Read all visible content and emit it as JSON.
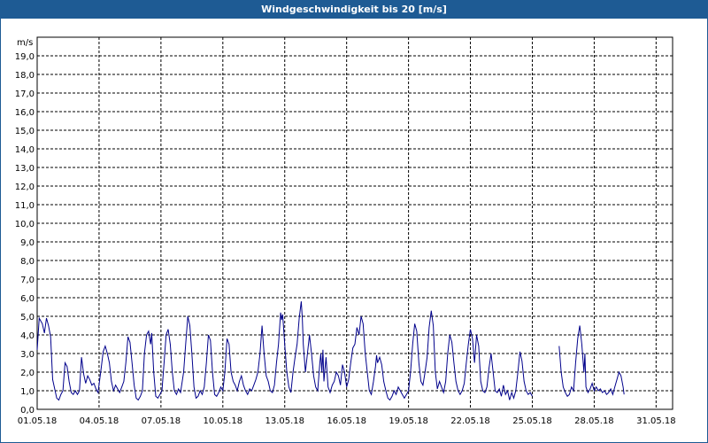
{
  "title": "Windgeschwindigkeit bis 20 [m/s]",
  "colors": {
    "titlebar": "#1e5b94",
    "series": "#00008b",
    "grid": "#000000"
  },
  "chart_data": {
    "type": "line",
    "title": "Windgeschwindigkeit bis 20 [m/s]",
    "ylabel": "m/s",
    "xlabel": "",
    "ylim": [
      0,
      20
    ],
    "y_ticks": [
      "0,0",
      "1,0",
      "2,0",
      "3,0",
      "4,0",
      "5,0",
      "6,0",
      "7,0",
      "8,0",
      "9,0",
      "10,0",
      "11,0",
      "12,0",
      "13,0",
      "14,0",
      "15,0",
      "16,0",
      "17,0",
      "18,0",
      "19,0"
    ],
    "x_tick_labels": [
      "01.05.18",
      "04.05.18",
      "07.05.18",
      "10.05.18",
      "13.05.18",
      "16.05.18",
      "19.05.18",
      "22.05.18",
      "25.05.18",
      "28.05.18",
      "31.05.18"
    ],
    "x_unit": "day of May 2018",
    "xlim": [
      1,
      31.8
    ],
    "grid": true,
    "series": [
      {
        "segments": [
          [
            [
              1.0,
              3.2
            ],
            [
              1.1,
              4.9
            ],
            [
              1.25,
              4.6
            ],
            [
              1.35,
              4.1
            ],
            [
              1.45,
              4.9
            ],
            [
              1.55,
              4.5
            ],
            [
              1.65,
              3.9
            ],
            [
              1.75,
              1.6
            ],
            [
              1.85,
              1.1
            ],
            [
              1.95,
              0.6
            ],
            [
              2.05,
              0.5
            ],
            [
              2.15,
              0.8
            ],
            [
              2.25,
              1.0
            ],
            [
              2.35,
              2.5
            ],
            [
              2.45,
              2.3
            ],
            [
              2.55,
              1.5
            ],
            [
              2.65,
              0.9
            ],
            [
              2.75,
              0.8
            ],
            [
              2.85,
              1.0
            ],
            [
              2.95,
              0.8
            ],
            [
              3.05,
              1.0
            ],
            [
              3.15,
              2.8
            ],
            [
              3.25,
              1.9
            ],
            [
              3.35,
              1.4
            ],
            [
              3.45,
              1.8
            ],
            [
              3.55,
              1.6
            ],
            [
              3.65,
              1.3
            ],
            [
              3.75,
              1.4
            ],
            [
              3.85,
              1.1
            ],
            [
              3.95,
              0.9
            ],
            [
              4.1,
              2.2
            ],
            [
              4.2,
              3.1
            ],
            [
              4.3,
              3.4
            ],
            [
              4.4,
              3.0
            ],
            [
              4.5,
              2.5
            ],
            [
              4.6,
              1.5
            ],
            [
              4.7,
              1.0
            ],
            [
              4.8,
              1.3
            ],
            [
              4.9,
              1.1
            ],
            [
              5.0,
              0.9
            ],
            [
              5.1,
              1.2
            ],
            [
              5.2,
              1.5
            ],
            [
              5.3,
              2.5
            ],
            [
              5.4,
              3.9
            ],
            [
              5.5,
              3.6
            ],
            [
              5.6,
              2.5
            ],
            [
              5.7,
              1.3
            ],
            [
              5.8,
              0.6
            ],
            [
              5.9,
              0.5
            ],
            [
              6.0,
              0.7
            ],
            [
              6.1,
              1.0
            ],
            [
              6.2,
              3.0
            ],
            [
              6.3,
              4.0
            ],
            [
              6.4,
              4.2
            ],
            [
              6.5,
              3.5
            ],
            [
              6.55,
              4.1
            ],
            [
              6.65,
              2.0
            ],
            [
              6.75,
              0.7
            ],
            [
              6.85,
              0.6
            ],
            [
              6.95,
              0.8
            ],
            [
              7.05,
              1.0
            ],
            [
              7.15,
              2.5
            ],
            [
              7.25,
              4.0
            ],
            [
              7.35,
              4.3
            ],
            [
              7.45,
              3.5
            ],
            [
              7.55,
              2.0
            ],
            [
              7.65,
              1.0
            ],
            [
              7.75,
              0.8
            ],
            [
              7.85,
              1.1
            ],
            [
              7.95,
              0.9
            ],
            [
              8.1,
              2.0
            ],
            [
              8.2,
              3.5
            ],
            [
              8.3,
              5.0
            ],
            [
              8.4,
              4.5
            ],
            [
              8.5,
              3.0
            ],
            [
              8.6,
              1.2
            ],
            [
              8.7,
              0.6
            ],
            [
              8.8,
              0.7
            ],
            [
              8.9,
              1.0
            ],
            [
              9.0,
              0.8
            ],
            [
              9.1,
              1.2
            ],
            [
              9.2,
              2.5
            ],
            [
              9.3,
              4.0
            ],
            [
              9.4,
              3.7
            ],
            [
              9.5,
              2.0
            ],
            [
              9.6,
              0.8
            ],
            [
              9.7,
              0.7
            ],
            [
              9.8,
              0.9
            ],
            [
              9.9,
              1.2
            ],
            [
              10.0,
              1.0
            ],
            [
              10.1,
              2.0
            ],
            [
              10.2,
              3.8
            ],
            [
              10.3,
              3.5
            ],
            [
              10.4,
              2.0
            ],
            [
              10.5,
              1.5
            ],
            [
              10.6,
              1.3
            ],
            [
              10.7,
              1.0
            ],
            [
              10.8,
              1.5
            ],
            [
              10.9,
              1.8
            ],
            [
              11.0,
              1.3
            ],
            [
              11.1,
              1.0
            ],
            [
              11.2,
              0.8
            ],
            [
              11.3,
              1.1
            ],
            [
              11.4,
              1.0
            ],
            [
              11.5,
              1.3
            ],
            [
              11.6,
              1.6
            ],
            [
              11.7,
              2.0
            ],
            [
              11.8,
              3.0
            ],
            [
              11.9,
              4.5
            ],
            [
              12.0,
              3.0
            ],
            [
              12.1,
              1.8
            ],
            [
              12.2,
              1.5
            ],
            [
              12.3,
              1.0
            ],
            [
              12.4,
              0.9
            ],
            [
              12.5,
              1.3
            ],
            [
              12.6,
              2.5
            ],
            [
              12.7,
              3.5
            ],
            [
              12.8,
              5.2
            ],
            [
              12.85,
              4.8
            ],
            [
              12.9,
              5.1
            ],
            [
              13.0,
              3.5
            ],
            [
              13.1,
              2.0
            ],
            [
              13.2,
              1.2
            ],
            [
              13.3,
              0.9
            ],
            [
              13.4,
              2.0
            ],
            [
              13.5,
              2.8
            ],
            [
              13.6,
              3.5
            ],
            [
              13.7,
              4.9
            ],
            [
              13.8,
              5.8
            ],
            [
              13.85,
              4.9
            ],
            [
              13.9,
              3.5
            ],
            [
              14.0,
              2.0
            ],
            [
              14.1,
              3.0
            ],
            [
              14.2,
              4.0
            ],
            [
              14.3,
              3.0
            ],
            [
              14.4,
              1.8
            ],
            [
              14.5,
              1.2
            ],
            [
              14.6,
              1.0
            ],
            [
              14.7,
              2.5
            ],
            [
              14.75,
              3.0
            ],
            [
              14.8,
              2.0
            ],
            [
              14.85,
              3.2
            ],
            [
              14.9,
              1.5
            ],
            [
              15.0,
              2.8
            ],
            [
              15.1,
              1.2
            ],
            [
              15.2,
              0.9
            ],
            [
              15.3,
              1.3
            ],
            [
              15.4,
              1.5
            ],
            [
              15.5,
              2.0
            ],
            [
              15.6,
              1.8
            ],
            [
              15.7,
              1.3
            ],
            [
              15.8,
              2.4
            ],
            [
              15.9,
              2.0
            ],
            [
              16.0,
              1.2
            ],
            [
              16.1,
              1.6
            ],
            [
              16.2,
              2.5
            ],
            [
              16.3,
              3.3
            ],
            [
              16.4,
              3.5
            ],
            [
              16.5,
              4.4
            ],
            [
              16.6,
              4.0
            ],
            [
              16.7,
              5.0
            ],
            [
              16.8,
              4.6
            ],
            [
              16.9,
              3.0
            ],
            [
              17.0,
              2.0
            ],
            [
              17.1,
              1.0
            ],
            [
              17.2,
              0.8
            ],
            [
              17.3,
              1.5
            ],
            [
              17.4,
              2.3
            ],
            [
              17.45,
              2.9
            ],
            [
              17.5,
              2.5
            ],
            [
              17.6,
              2.8
            ],
            [
              17.7,
              2.4
            ],
            [
              17.8,
              1.5
            ],
            [
              17.9,
              1.0
            ],
            [
              18.0,
              0.6
            ],
            [
              18.1,
              0.5
            ],
            [
              18.2,
              0.7
            ],
            [
              18.3,
              1.0
            ],
            [
              18.4,
              0.8
            ],
            [
              18.5,
              1.2
            ],
            [
              18.6,
              1.0
            ],
            [
              18.7,
              0.8
            ],
            [
              18.8,
              0.6
            ],
            [
              18.9,
              0.8
            ],
            [
              19.0,
              1.0
            ],
            [
              19.1,
              2.0
            ],
            [
              19.2,
              3.5
            ],
            [
              19.3,
              4.6
            ],
            [
              19.4,
              4.2
            ],
            [
              19.5,
              2.5
            ],
            [
              19.6,
              1.5
            ],
            [
              19.7,
              1.3
            ],
            [
              19.8,
              2.0
            ],
            [
              19.9,
              2.8
            ],
            [
              20.0,
              4.4
            ],
            [
              20.1,
              5.3
            ],
            [
              20.2,
              4.5
            ],
            [
              20.3,
              2.0
            ],
            [
              20.4,
              1.1
            ],
            [
              20.5,
              1.5
            ],
            [
              20.6,
              1.2
            ],
            [
              20.7,
              0.9
            ],
            [
              20.8,
              1.5
            ],
            [
              20.9,
              3.0
            ],
            [
              21.0,
              4.0
            ],
            [
              21.1,
              3.6
            ],
            [
              21.2,
              2.5
            ],
            [
              21.3,
              1.5
            ],
            [
              21.4,
              1.0
            ],
            [
              21.5,
              0.8
            ],
            [
              21.6,
              1.0
            ],
            [
              21.7,
              1.4
            ],
            [
              21.8,
              2.5
            ],
            [
              21.9,
              3.5
            ],
            [
              22.0,
              4.3
            ],
            [
              22.1,
              3.8
            ],
            [
              22.2,
              2.5
            ],
            [
              22.3,
              4.0
            ],
            [
              22.4,
              3.4
            ],
            [
              22.5,
              1.5
            ],
            [
              22.6,
              1.0
            ],
            [
              22.7,
              0.9
            ],
            [
              22.8,
              1.2
            ],
            [
              22.9,
              2.2
            ],
            [
              23.0,
              3.0
            ],
            [
              23.1,
              2.0
            ],
            [
              23.2,
              1.0
            ],
            [
              23.3,
              0.9
            ],
            [
              23.4,
              1.1
            ],
            [
              23.5,
              0.7
            ],
            [
              23.6,
              1.3
            ],
            [
              23.7,
              0.8
            ],
            [
              23.8,
              1.0
            ],
            [
              23.9,
              0.5
            ],
            [
              24.0,
              0.9
            ],
            [
              24.1,
              0.6
            ],
            [
              24.2,
              1.0
            ],
            [
              24.3,
              2.0
            ],
            [
              24.4,
              3.1
            ],
            [
              24.5,
              2.6
            ],
            [
              24.6,
              1.5
            ],
            [
              24.7,
              1.0
            ],
            [
              24.8,
              0.8
            ],
            [
              24.9,
              0.9
            ],
            [
              25.0,
              0.7
            ]
          ],
          [
            [
              26.3,
              3.4
            ],
            [
              26.4,
              2.0
            ],
            [
              26.5,
              1.2
            ],
            [
              26.6,
              0.9
            ],
            [
              26.7,
              0.7
            ],
            [
              26.8,
              0.8
            ],
            [
              26.9,
              1.2
            ],
            [
              27.0,
              1.0
            ],
            [
              27.1,
              2.5
            ],
            [
              27.2,
              3.8
            ],
            [
              27.3,
              4.5
            ],
            [
              27.4,
              3.5
            ],
            [
              27.5,
              2.0
            ],
            [
              27.55,
              3.0
            ],
            [
              27.6,
              1.2
            ],
            [
              27.7,
              0.9
            ],
            [
              27.8,
              1.1
            ],
            [
              27.9,
              1.4
            ],
            [
              28.0,
              1.0
            ],
            [
              28.1,
              1.2
            ],
            [
              28.2,
              1.0
            ],
            [
              28.3,
              1.1
            ],
            [
              28.4,
              0.9
            ],
            [
              28.5,
              1.0
            ],
            [
              28.6,
              0.8
            ],
            [
              28.7,
              0.9
            ],
            [
              28.8,
              1.1
            ],
            [
              28.9,
              0.8
            ],
            [
              29.0,
              1.2
            ],
            [
              29.1,
              1.6
            ],
            [
              29.2,
              2.0
            ],
            [
              29.3,
              1.8
            ],
            [
              29.4,
              1.2
            ],
            [
              29.45,
              0.8
            ]
          ]
        ]
      }
    ]
  }
}
